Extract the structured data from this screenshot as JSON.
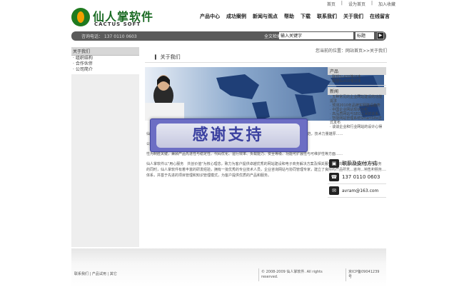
{
  "top_links": [
    "首页",
    "设为首页",
    "加入收藏"
  ],
  "logo": {
    "cn": "仙人掌软件",
    "en": "CACTUS SOFT"
  },
  "nav": [
    "产品中心",
    "成功案例",
    "新闻与观点",
    "帮助",
    "下载",
    "联系我们",
    "关于我们",
    "在线留言"
  ],
  "hotline": "咨询电话： 137 0110 0603",
  "search": {
    "label": "全文检索",
    "placeholder": "输入关键字",
    "scope": "标题",
    "go": "▶"
  },
  "left_menu": {
    "title": "关于我们",
    "items": [
      "组织结构",
      "合作伙伴",
      "公司简介"
    ]
  },
  "page": {
    "title": "关于我们",
    "breadcrumb": "您当前的位置：网站首页>>关于我们"
  },
  "popup": {
    "message": "感谢支持"
  },
  "body_text": [
    "仙人掌软件（cactussoft）是一家专注于企业网站建设与网络营销的软件公司，机构设置合理，管理规范，技术力量雄厚……",
    "公司致力于为客户提供优质的网站解决方案与软件产品，以质量稳定、功能强大、安全易用著称……",
    "性为制胜关键，兼顾产品先进性与稳定性、代码优化、运行效率、负载能力、安全等级、功能可扩展性与可维护性等方面……",
    "仙人掌软件以\"用心服务　共创价值\"为核心理念，致力为客户提供卓越优秀的网站建设和电子商务解决方案及相关服务。在向中国市场提供技术与服务的同时，仙人掌软件有着丰富的研发经验，拥有一批优秀的专业技术人员，企业咨询网站与协同管理专家，建立了良好的产品研发、咨询、销售和服务体系，并基于先进的项目管理和知识管理模式，为客户提供优质的产品和服务。"
  ],
  "right": {
    "products_title": "产品",
    "products": [
      "联想SL420笔记本",
      "联想SL410笔记本"
    ],
    "news_title": "新闻",
    "news": [
      "五种常见的企业网站建设的功能需求",
      "预测2010年品牌实网建设趋势",
      "中国企业网站现状分析",
      "高品质网站与SEO之间的关系",
      "智能网站管理系统SmartSite正式发布",
      "谈谈企业和行业网站的设计心得"
    ]
  },
  "contact": {
    "title": "联系及支付方式",
    "phone": "137 0110 0603",
    "email": "avram@163.com"
  },
  "footer": {
    "links": "联系我们 | 产品试用 | 其它",
    "copyright": "© 2008-2009 仙人掌软件. All rights reserved.",
    "icp": "京ICP备09041239号"
  },
  "colors": {
    "bar": "#5a5a5a",
    "popup": "#6c6ec4",
    "popup_text": "#3b41a0",
    "logo_green": "#1b6b24"
  }
}
